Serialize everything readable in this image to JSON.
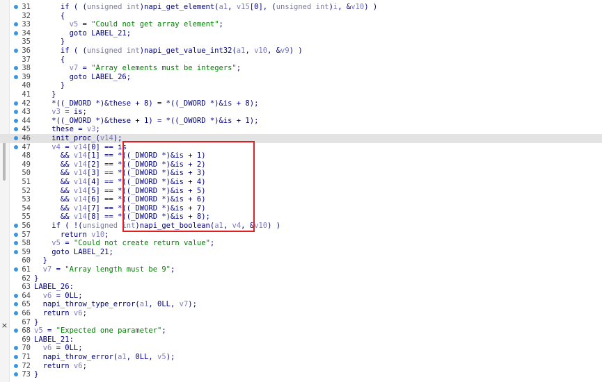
{
  "editor": {
    "close_label": "×",
    "lines": [
      {
        "n": "31",
        "dot": true,
        "t": "      if ( (unsigned int)napi_get_element(a1, v15[0], (unsigned int)i, &v10) )"
      },
      {
        "n": "32",
        "dot": false,
        "t": "      {"
      },
      {
        "n": "33",
        "dot": true,
        "t": "        v5 = \"Could not get array element\";"
      },
      {
        "n": "34",
        "dot": true,
        "t": "        goto LABEL_21;"
      },
      {
        "n": "35",
        "dot": false,
        "t": "      }"
      },
      {
        "n": "36",
        "dot": true,
        "t": "      if ( (unsigned int)napi_get_value_int32(a1, v10, &v9) )"
      },
      {
        "n": "37",
        "dot": false,
        "t": "      {"
      },
      {
        "n": "38",
        "dot": true,
        "t": "        v7 = \"Array elements must be integers\";"
      },
      {
        "n": "39",
        "dot": true,
        "t": "        goto LABEL_26;"
      },
      {
        "n": "40",
        "dot": false,
        "t": "      }"
      },
      {
        "n": "41",
        "dot": false,
        "t": "    }"
      },
      {
        "n": "42",
        "dot": true,
        "t": "    *((_DWORD *)&these + 8) = *((_DWORD *)&is + 8);"
      },
      {
        "n": "43",
        "dot": true,
        "t": "    v3 = is;"
      },
      {
        "n": "44",
        "dot": true,
        "t": "    *((_OWORD *)&these + 1) = *((_OWORD *)&is + 1);"
      },
      {
        "n": "45",
        "dot": true,
        "t": "    these = v3;"
      },
      {
        "n": "46",
        "dot": true,
        "t": "    init_proc_(v14);",
        "current": true
      },
      {
        "n": "47",
        "dot": true,
        "t": "    v4 = v14[0] == is"
      },
      {
        "n": "48",
        "dot": false,
        "t": "      && v14[1] == *((_DWORD *)&is + 1)"
      },
      {
        "n": "49",
        "dot": false,
        "t": "      && v14[2] == *((_DWORD *)&is + 2)"
      },
      {
        "n": "50",
        "dot": false,
        "t": "      && v14[3] == *((_DWORD *)&is + 3)"
      },
      {
        "n": "51",
        "dot": false,
        "t": "      && v14[4] == *((_DWORD *)&is + 4)"
      },
      {
        "n": "52",
        "dot": false,
        "t": "      && v14[5] == *((_DWORD *)&is + 5)"
      },
      {
        "n": "53",
        "dot": false,
        "t": "      && v14[6] == *((_DWORD *)&is + 6)"
      },
      {
        "n": "54",
        "dot": false,
        "t": "      && v14[7] == *((_DWORD *)&is + 7)"
      },
      {
        "n": "55",
        "dot": false,
        "t": "      && v14[8] == *((_DWORD *)&is + 8);"
      },
      {
        "n": "56",
        "dot": true,
        "t": "    if ( !(unsigned int)napi_get_boolean(a1, v4, &v10) )"
      },
      {
        "n": "57",
        "dot": true,
        "t": "      return v10;"
      },
      {
        "n": "58",
        "dot": true,
        "t": "    v5 = \"Could not create return value\";"
      },
      {
        "n": "59",
        "dot": true,
        "t": "    goto LABEL_21;"
      },
      {
        "n": "60",
        "dot": false,
        "t": "  }"
      },
      {
        "n": "61",
        "dot": true,
        "t": "  v7 = \"Array length must be 9\";"
      },
      {
        "n": "62",
        "dot": false,
        "t": "}"
      },
      {
        "n": "63",
        "dot": false,
        "t": "LABEL_26:"
      },
      {
        "n": "64",
        "dot": true,
        "t": "  v6 = 0LL;"
      },
      {
        "n": "65",
        "dot": true,
        "t": "  napi_throw_type_error(a1, 0LL, v7);"
      },
      {
        "n": "66",
        "dot": true,
        "t": "  return v6;"
      },
      {
        "n": "67",
        "dot": false,
        "t": "}"
      },
      {
        "n": "68",
        "dot": true,
        "t": "v5 = \"Expected one parameter\";"
      },
      {
        "n": "69",
        "dot": false,
        "t": "LABEL_21:"
      },
      {
        "n": "70",
        "dot": true,
        "t": "  v6 = 0LL;"
      },
      {
        "n": "71",
        "dot": true,
        "t": "  napi_throw_error(a1, 0LL, v5);"
      },
      {
        "n": "72",
        "dot": true,
        "t": "  return v6;"
      },
      {
        "n": "73",
        "dot": true,
        "t": "}"
      }
    ],
    "colors": {
      "background": "#ffffff",
      "current_line": "#e3e3e3",
      "breakpoint_dot": "#3d95e0",
      "code": "#000080",
      "string": "#008000",
      "variable": "#7b7bbf",
      "highlight_box": "#e02020"
    }
  }
}
